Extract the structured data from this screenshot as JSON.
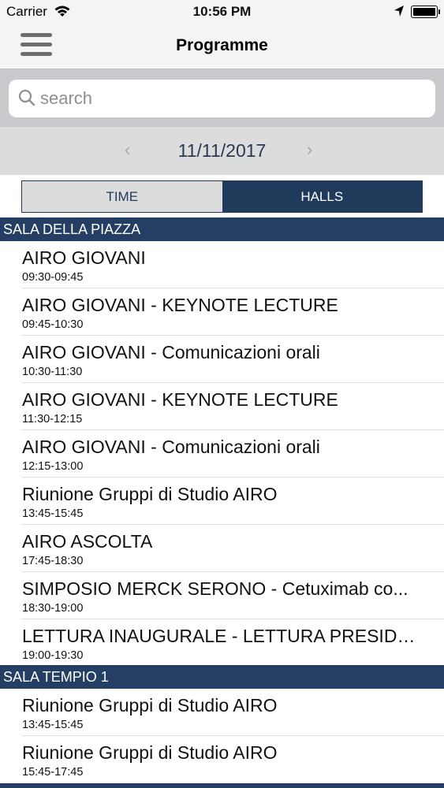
{
  "status": {
    "carrier": "Carrier",
    "time": "10:56 PM"
  },
  "nav": {
    "title": "Programme"
  },
  "search": {
    "placeholder": "search"
  },
  "date": {
    "value": "11/11/2017",
    "prev": "‹",
    "next": "›"
  },
  "tabs": {
    "time": "TIME",
    "halls": "HALLS",
    "selected": "HALLS"
  },
  "sections": [
    {
      "title": "SALA DELLA PIAZZA",
      "items": [
        {
          "name": "AIRO GIOVANI",
          "time": "09:30-09:45"
        },
        {
          "name": "AIRO GIOVANI - KEYNOTE LECTURE",
          "time": "09:45-10:30"
        },
        {
          "name": "AIRO GIOVANI - Comunicazioni orali",
          "time": "10:30-11:30"
        },
        {
          "name": "AIRO GIOVANI - KEYNOTE LECTURE",
          "time": "11:30-12:15"
        },
        {
          "name": "AIRO GIOVANI - Comunicazioni orali",
          "time": "12:15-13:00"
        },
        {
          "name": "Riunione Gruppi di Studio AIRO",
          "time": "13:45-15:45"
        },
        {
          "name": "AIRO ASCOLTA",
          "time": "17:45-18:30"
        },
        {
          "name": "SIMPOSIO MERCK SERONO - Cetuximab co...",
          "time": "18:30-19:00"
        },
        {
          "name": "LETTURA INAUGURALE - LETTURA PRESIDEN...",
          "time": "19:00-19:30"
        }
      ]
    },
    {
      "title": "SALA TEMPIO 1",
      "items": [
        {
          "name": "Riunione Gruppi di Studio AIRO",
          "time": "13:45-15:45"
        },
        {
          "name": "Riunione Gruppi di Studio AIRO",
          "time": "15:45-17:45"
        }
      ]
    }
  ]
}
